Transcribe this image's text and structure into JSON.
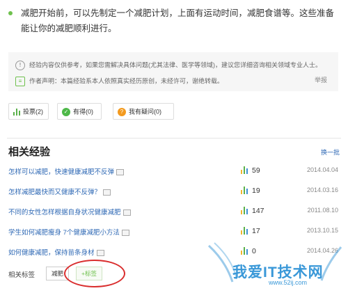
{
  "intro": {
    "text": "减肥开始前，可以先制定一个减肥计划，上面有运动时间，减肥食谱等。这些准备能让你的减肥顺利进行。"
  },
  "notice": {
    "disclaimer": "经验内容仅供参考，如果您需解决具体问题(尤其法律、医学等领域)，建议您详细咨询相关领域专业人士。",
    "author_statement": "作者声明：本篇经验系本人依照真实经历原创，未经许可，谢绝转载。",
    "report_label": "举报"
  },
  "actions": {
    "vote_label": "投票(2)",
    "useful_label": "有得(0)",
    "question_label": "我有疑问(0)"
  },
  "related": {
    "title": "相关经验",
    "refresh_label": "换一批",
    "items": [
      {
        "title": "怎样可以减肥，快速健康减肥不反弹",
        "count": "59",
        "date": "2014.04.04"
      },
      {
        "title": "怎样减肥最快而又健康不反弹？",
        "count": "19",
        "date": "2014.03.16"
      },
      {
        "title": "不同的女性怎样根据自身状况健康减肥",
        "count": "147",
        "date": "2011.08.10"
      },
      {
        "title": "学生如何减肥瘦身 7个健康减肥小方法",
        "count": "17",
        "date": "2013.10.15"
      },
      {
        "title": "如何健康减肥，保持苗条身材",
        "count": "0",
        "date": "2014.04.26"
      }
    ]
  },
  "tags": {
    "label": "相关标签",
    "items": [
      "减肥"
    ],
    "add_label": "+标签"
  },
  "watermark": {
    "brand": "我爱IT技术网",
    "url": "www.52ij.com"
  },
  "colors": {
    "link": "#2f69b5",
    "accent_green": "#6fc14e",
    "highlight_red": "#d92c2c",
    "watermark_blue": "#3a98d8"
  }
}
